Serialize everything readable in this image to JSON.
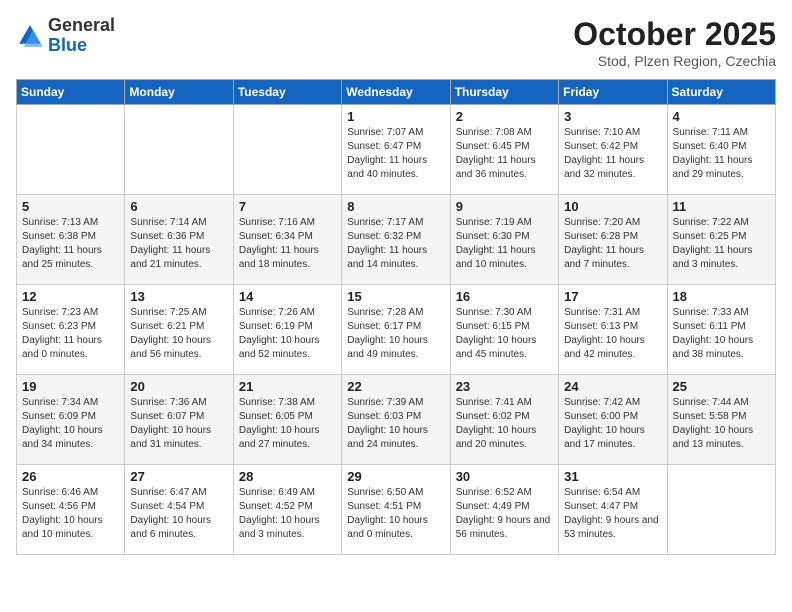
{
  "header": {
    "logo_general": "General",
    "logo_blue": "Blue",
    "month": "October 2025",
    "location": "Stod, Plzen Region, Czechia"
  },
  "days_of_week": [
    "Sunday",
    "Monday",
    "Tuesday",
    "Wednesday",
    "Thursday",
    "Friday",
    "Saturday"
  ],
  "weeks": [
    [
      {
        "day": "",
        "info": ""
      },
      {
        "day": "",
        "info": ""
      },
      {
        "day": "",
        "info": ""
      },
      {
        "day": "1",
        "info": "Sunrise: 7:07 AM\nSunset: 6:47 PM\nDaylight: 11 hours and 40 minutes."
      },
      {
        "day": "2",
        "info": "Sunrise: 7:08 AM\nSunset: 6:45 PM\nDaylight: 11 hours and 36 minutes."
      },
      {
        "day": "3",
        "info": "Sunrise: 7:10 AM\nSunset: 6:42 PM\nDaylight: 11 hours and 32 minutes."
      },
      {
        "day": "4",
        "info": "Sunrise: 7:11 AM\nSunset: 6:40 PM\nDaylight: 11 hours and 29 minutes."
      }
    ],
    [
      {
        "day": "5",
        "info": "Sunrise: 7:13 AM\nSunset: 6:38 PM\nDaylight: 11 hours and 25 minutes."
      },
      {
        "day": "6",
        "info": "Sunrise: 7:14 AM\nSunset: 6:36 PM\nDaylight: 11 hours and 21 minutes."
      },
      {
        "day": "7",
        "info": "Sunrise: 7:16 AM\nSunset: 6:34 PM\nDaylight: 11 hours and 18 minutes."
      },
      {
        "day": "8",
        "info": "Sunrise: 7:17 AM\nSunset: 6:32 PM\nDaylight: 11 hours and 14 minutes."
      },
      {
        "day": "9",
        "info": "Sunrise: 7:19 AM\nSunset: 6:30 PM\nDaylight: 11 hours and 10 minutes."
      },
      {
        "day": "10",
        "info": "Sunrise: 7:20 AM\nSunset: 6:28 PM\nDaylight: 11 hours and 7 minutes."
      },
      {
        "day": "11",
        "info": "Sunrise: 7:22 AM\nSunset: 6:25 PM\nDaylight: 11 hours and 3 minutes."
      }
    ],
    [
      {
        "day": "12",
        "info": "Sunrise: 7:23 AM\nSunset: 6:23 PM\nDaylight: 11 hours and 0 minutes."
      },
      {
        "day": "13",
        "info": "Sunrise: 7:25 AM\nSunset: 6:21 PM\nDaylight: 10 hours and 56 minutes."
      },
      {
        "day": "14",
        "info": "Sunrise: 7:26 AM\nSunset: 6:19 PM\nDaylight: 10 hours and 52 minutes."
      },
      {
        "day": "15",
        "info": "Sunrise: 7:28 AM\nSunset: 6:17 PM\nDaylight: 10 hours and 49 minutes."
      },
      {
        "day": "16",
        "info": "Sunrise: 7:30 AM\nSunset: 6:15 PM\nDaylight: 10 hours and 45 minutes."
      },
      {
        "day": "17",
        "info": "Sunrise: 7:31 AM\nSunset: 6:13 PM\nDaylight: 10 hours and 42 minutes."
      },
      {
        "day": "18",
        "info": "Sunrise: 7:33 AM\nSunset: 6:11 PM\nDaylight: 10 hours and 38 minutes."
      }
    ],
    [
      {
        "day": "19",
        "info": "Sunrise: 7:34 AM\nSunset: 6:09 PM\nDaylight: 10 hours and 34 minutes."
      },
      {
        "day": "20",
        "info": "Sunrise: 7:36 AM\nSunset: 6:07 PM\nDaylight: 10 hours and 31 minutes."
      },
      {
        "day": "21",
        "info": "Sunrise: 7:38 AM\nSunset: 6:05 PM\nDaylight: 10 hours and 27 minutes."
      },
      {
        "day": "22",
        "info": "Sunrise: 7:39 AM\nSunset: 6:03 PM\nDaylight: 10 hours and 24 minutes."
      },
      {
        "day": "23",
        "info": "Sunrise: 7:41 AM\nSunset: 6:02 PM\nDaylight: 10 hours and 20 minutes."
      },
      {
        "day": "24",
        "info": "Sunrise: 7:42 AM\nSunset: 6:00 PM\nDaylight: 10 hours and 17 minutes."
      },
      {
        "day": "25",
        "info": "Sunrise: 7:44 AM\nSunset: 5:58 PM\nDaylight: 10 hours and 13 minutes."
      }
    ],
    [
      {
        "day": "26",
        "info": "Sunrise: 6:46 AM\nSunset: 4:56 PM\nDaylight: 10 hours and 10 minutes."
      },
      {
        "day": "27",
        "info": "Sunrise: 6:47 AM\nSunset: 4:54 PM\nDaylight: 10 hours and 6 minutes."
      },
      {
        "day": "28",
        "info": "Sunrise: 6:49 AM\nSunset: 4:52 PM\nDaylight: 10 hours and 3 minutes."
      },
      {
        "day": "29",
        "info": "Sunrise: 6:50 AM\nSunset: 4:51 PM\nDaylight: 10 hours and 0 minutes."
      },
      {
        "day": "30",
        "info": "Sunrise: 6:52 AM\nSunset: 4:49 PM\nDaylight: 9 hours and 56 minutes."
      },
      {
        "day": "31",
        "info": "Sunrise: 6:54 AM\nSunset: 4:47 PM\nDaylight: 9 hours and 53 minutes."
      },
      {
        "day": "",
        "info": ""
      }
    ]
  ]
}
